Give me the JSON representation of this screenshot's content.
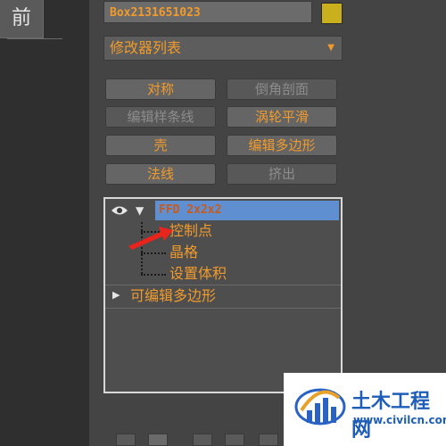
{
  "viewport": {
    "label": "前"
  },
  "object": {
    "name": "Box2131651023",
    "color": "#c9b01c"
  },
  "modifier_list": {
    "label": "修改器列表",
    "arrow": "▼"
  },
  "buttons": [
    {
      "label": "对称",
      "enabled": true
    },
    {
      "label": "倒角剖面",
      "enabled": false
    },
    {
      "label": "编辑样条线",
      "enabled": false
    },
    {
      "label": "涡轮平滑",
      "enabled": true
    },
    {
      "label": "壳",
      "enabled": true
    },
    {
      "label": "编辑多边形",
      "enabled": true
    },
    {
      "label": "法线",
      "enabled": true
    },
    {
      "label": "挤出",
      "enabled": false
    }
  ],
  "stack": {
    "ffd": {
      "label": "FFD 2x2x2"
    },
    "sub_items": [
      "控制点",
      "晶格",
      "设置体积"
    ],
    "edit_poly": {
      "label": "可编辑多边形"
    }
  },
  "watermark": {
    "title": "土木工程网",
    "url": "www.civilcn.com"
  },
  "colors": {
    "accent": "#f19b2c",
    "selection": "#5f8fd0",
    "annotation": "#e8241c"
  }
}
